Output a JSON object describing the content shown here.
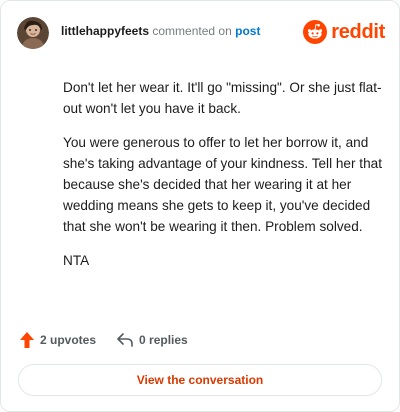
{
  "header": {
    "avatar_icon": "user-avatar",
    "username": "littlehappyfeets",
    "action_text": "commented on",
    "post_link": "post",
    "brand_icon": "reddit-snoo-icon",
    "brand_text": "reddit"
  },
  "comment": {
    "paragraphs": [
      "Don't let her wear it. It'll go \"missing\". Or she just flat-out won't let you have it back.",
      "You were generous to offer to let her borrow it, and she's taking advantage of your kindness. Tell her that because she's decided that her wearing it at her wedding means she gets to keep it, you've decided that she won't be wearing it then. Problem solved.",
      "NTA"
    ]
  },
  "footer": {
    "upvotes": "2 upvotes",
    "upvote_icon": "upvote-arrow-icon",
    "replies": "0 replies",
    "reply_icon": "reply-icon"
  },
  "cta": {
    "label": "View the conversation"
  },
  "colors": {
    "brand": "#ff4500",
    "link": "#0079d3",
    "cta_text": "#d93900",
    "muted": "#787c7e"
  }
}
